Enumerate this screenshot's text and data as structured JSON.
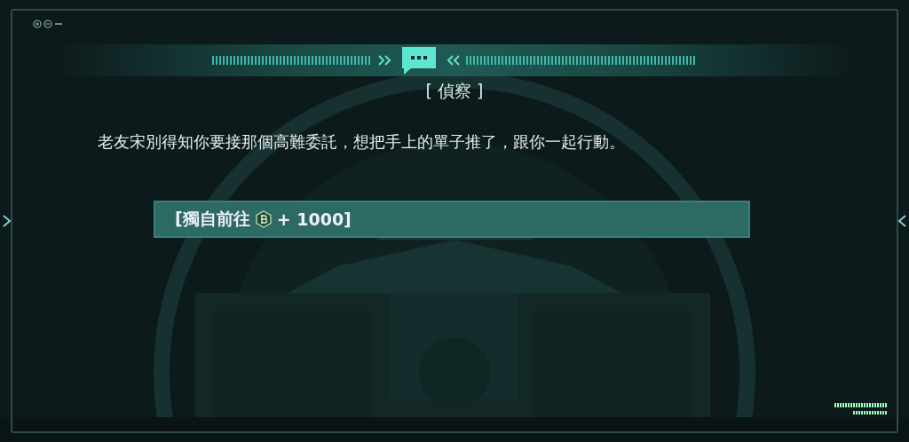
{
  "dialog": {
    "title": "[ 偵察 ]",
    "message": "老友宋別得知你要接那個高難委託，想把手上的單子推了，跟你一起行動。"
  },
  "choices": [
    {
      "label_before": "[獨自前往",
      "cost": "+ 1000]",
      "selected": true
    }
  ]
}
